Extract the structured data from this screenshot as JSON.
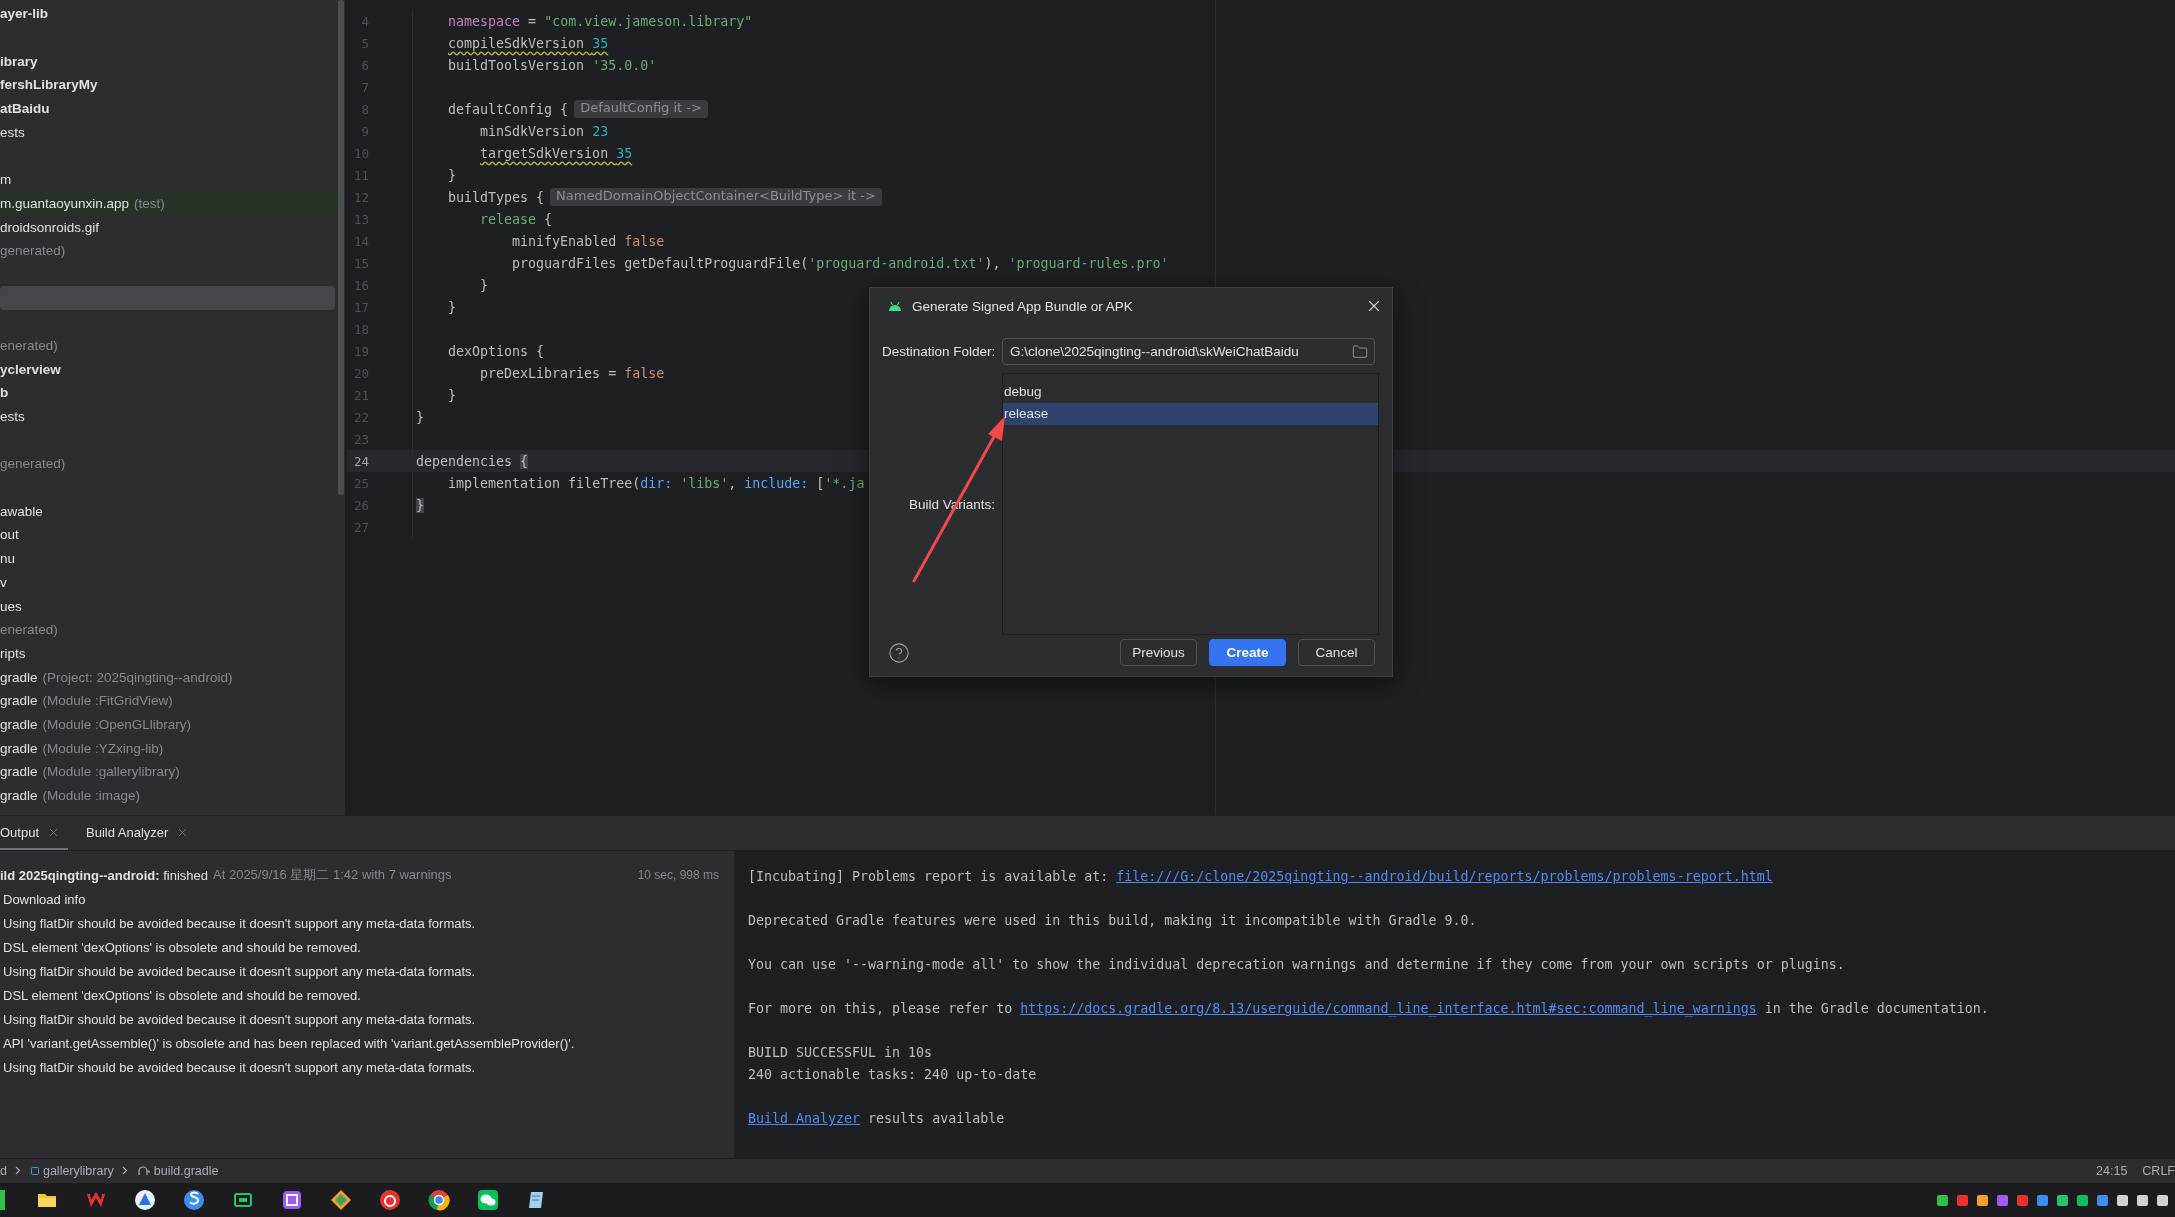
{
  "project_tree": {
    "rows": [
      {
        "kind": "module",
        "label": "ayer-lib",
        "selected": false
      },
      {
        "kind": "gap",
        "selected": false
      },
      {
        "kind": "module",
        "label": "ibrary",
        "selected": false
      },
      {
        "kind": "module",
        "label": "fershLibraryMy",
        "selected": false
      },
      {
        "kind": "module",
        "label": "atBaidu",
        "selected": false
      },
      {
        "kind": "folder",
        "label": "ests",
        "selected": false
      },
      {
        "kind": "gap",
        "selected": false
      },
      {
        "kind": "folder",
        "label": "m",
        "selected": false
      },
      {
        "kind": "test",
        "label": "m.guantaoyunxin.app",
        "note": "(test)",
        "selected": false
      },
      {
        "kind": "folder",
        "label": "droidsonroids.gif",
        "selected": false
      },
      {
        "kind": "folder",
        "note": "generated)",
        "selected": false
      },
      {
        "kind": "gap",
        "selected": false
      },
      {
        "kind": "gap",
        "selected": true
      },
      {
        "kind": "gap",
        "selected": false
      },
      {
        "kind": "folder",
        "note": "enerated)",
        "selected": false
      },
      {
        "kind": "module",
        "label": "yclerview",
        "selected": false
      },
      {
        "kind": "module",
        "label": "b",
        "selected": false
      },
      {
        "kind": "folder",
        "label": "ests",
        "selected": false
      },
      {
        "kind": "gap",
        "selected": false
      },
      {
        "kind": "folder",
        "note": "generated)",
        "selected": false
      },
      {
        "kind": "gap",
        "selected": false
      },
      {
        "kind": "folder",
        "label": "awable",
        "selected": false
      },
      {
        "kind": "folder",
        "label": "out",
        "selected": false
      },
      {
        "kind": "folder",
        "label": "nu",
        "selected": false
      },
      {
        "kind": "folder",
        "label": "v",
        "selected": false
      },
      {
        "kind": "folder",
        "label": "ues",
        "selected": false
      },
      {
        "kind": "folder",
        "note": "enerated)",
        "selected": false
      },
      {
        "kind": "folder",
        "label": "ripts",
        "selected": false
      },
      {
        "kind": "folder",
        "label": "gradle",
        "note": "(Project: 2025qingting--android)",
        "selected": false
      },
      {
        "kind": "folder",
        "label": "gradle",
        "note": "(Module :FitGridView)",
        "selected": false
      },
      {
        "kind": "folder",
        "label": "gradle",
        "note": "(Module :OpenGLlibrary)",
        "selected": false
      },
      {
        "kind": "folder",
        "label": "gradle",
        "note": "(Module :YZxing-lib)",
        "selected": false
      },
      {
        "kind": "folder",
        "label": "gradle",
        "note": "(Module :gallerylibrary)",
        "selected": false
      },
      {
        "kind": "folder",
        "label": "gradle",
        "note": "(Module :image)",
        "selected": false
      }
    ]
  },
  "editor": {
    "lines": [
      {
        "number": "4",
        "current": false,
        "tokens": [
          {
            "text": "    namespace",
            "kind": "property"
          },
          {
            "text": " = "
          },
          {
            "text": "\"com.view.jameson.library\"",
            "kind": "string"
          }
        ]
      },
      {
        "number": "5",
        "current": false,
        "tokens": [
          {
            "text": "    compileSdkVersion ",
            "wavy": true
          },
          {
            "text": "35",
            "kind": "number",
            "wavy": true
          }
        ]
      },
      {
        "number": "6",
        "current": false,
        "tokens": [
          {
            "text": "    buildToolsVersion "
          },
          {
            "text": "'35.0.0'",
            "kind": "string"
          }
        ]
      },
      {
        "number": "7",
        "current": false
      },
      {
        "number": "8",
        "current": false,
        "tokens": [
          {
            "text": "    defaultConfig {"
          }
        ],
        "hint": "DefaultConfig it ->"
      },
      {
        "number": "9",
        "current": false,
        "tokens": [
          {
            "text": "        minSdkVersion "
          },
          {
            "text": "23",
            "kind": "number"
          }
        ]
      },
      {
        "number": "10",
        "current": false,
        "tokens": [
          {
            "text": "        targetSdkVersion ",
            "wavy": true
          },
          {
            "text": "35",
            "kind": "number",
            "wavy": true
          }
        ]
      },
      {
        "number": "11",
        "current": false,
        "tokens": [
          {
            "text": "    }"
          }
        ]
      },
      {
        "number": "12",
        "current": false,
        "tokens": [
          {
            "text": "    buildTypes {"
          }
        ],
        "hint": "NamedDomainObjectContainer<BuildType> it ->"
      },
      {
        "number": "13",
        "current": false,
        "tokens": [
          {
            "text": "        release",
            "kind": "string"
          },
          {
            "text": " {"
          }
        ]
      },
      {
        "number": "14",
        "current": false,
        "tokens": [
          {
            "text": "            minifyEnabled "
          },
          {
            "text": "false",
            "kind": "keyword"
          }
        ]
      },
      {
        "number": "15",
        "current": false,
        "tokens": [
          {
            "text": "            proguardFiles getDefaultProguardFile("
          },
          {
            "text": "'proguard-android.txt'",
            "kind": "string"
          },
          {
            "text": "), "
          },
          {
            "text": "'proguard-rules.pro'",
            "kind": "string"
          }
        ]
      },
      {
        "number": "16",
        "current": false,
        "tokens": [
          {
            "text": "        }"
          }
        ]
      },
      {
        "number": "17",
        "current": false,
        "tokens": [
          {
            "text": "    }"
          }
        ]
      },
      {
        "number": "18",
        "current": false
      },
      {
        "number": "19",
        "current": false,
        "tokens": [
          {
            "text": "    dexOptions {"
          }
        ]
      },
      {
        "number": "20",
        "current": false,
        "tokens": [
          {
            "text": "        preDexLibraries = "
          },
          {
            "text": "false",
            "kind": "keyword"
          }
        ]
      },
      {
        "number": "21",
        "current": false,
        "tokens": [
          {
            "text": "    }"
          }
        ]
      },
      {
        "number": "22",
        "current": false,
        "tokens": [
          {
            "text": "}"
          }
        ]
      },
      {
        "number": "23",
        "current": false
      },
      {
        "number": "24",
        "current": true,
        "tokens": [
          {
            "text": "dependencies "
          },
          {
            "text": "{",
            "kind": "matched"
          }
        ]
      },
      {
        "number": "25",
        "current": false,
        "tokens": [
          {
            "text": "    implementation fileTree("
          },
          {
            "text": "dir:",
            "kind": "param"
          },
          {
            "text": " 'libs'",
            "kind": "string"
          },
          {
            "text": ", "
          },
          {
            "text": "include:",
            "kind": "param"
          },
          {
            "text": " ["
          },
          {
            "text": "'*.ja",
            "kind": "string"
          }
        ]
      },
      {
        "number": "26",
        "current": false,
        "tokens": [
          {
            "text": "}",
            "kind": "matched"
          }
        ]
      },
      {
        "number": "27",
        "current": false
      }
    ]
  },
  "dialog": {
    "title": "Generate Signed App Bundle or APK",
    "destination_label": "Destination Folder:",
    "destination_value": "G:\\clone\\2025qingting--android\\skWeiChatBaidu",
    "variants_label": "Build Variants:",
    "variants": [
      {
        "label": "debug",
        "selected": false
      },
      {
        "label": "release",
        "selected": true
      }
    ],
    "buttons": [
      {
        "label": "Previous",
        "kind": "secondary"
      },
      {
        "label": "Create",
        "kind": "primary"
      },
      {
        "label": "Cancel",
        "kind": "secondary"
      }
    ]
  },
  "bottom_panel": {
    "tabs": [
      {
        "label": "Output",
        "selected": true
      },
      {
        "label": "Build Analyzer",
        "selected": false
      }
    ],
    "build_summary": {
      "text": "**ild 2025qingting--android:** finished",
      "detail": "At 2025/9/16 星期二 1:42 with 7 warnings",
      "duration": "10 sec, 998 ms"
    },
    "messages": [
      "Download info",
      "Using flatDir should be avoided because it doesn't support any meta-data formats.",
      "DSL element 'dexOptions' is obsolete and should be removed.",
      "Using flatDir should be avoided because it doesn't support any meta-data formats.",
      "DSL element 'dexOptions' is obsolete and should be removed.",
      "Using flatDir should be avoided because it doesn't support any meta-data formats.",
      "API 'variant.getAssemble()' is obsolete and has been replaced with 'variant.getAssembleProvider()'.",
      "Using flatDir should be avoided because it doesn't support any meta-data formats."
    ],
    "console": [
      {
        "kind": "text",
        "parts": [
          {
            "text": "[Incubating] Problems report is available at: ",
            "link": false
          },
          {
            "text": "file:///G:/clone/2025qingting--android/build/reports/problems/problems-report.html",
            "link": true
          }
        ]
      },
      {
        "kind": "blank"
      },
      {
        "kind": "text",
        "parts": [
          {
            "text": "Deprecated Gradle features were used in this build, making it incompatible with Gradle 9.0.",
            "link": false
          }
        ]
      },
      {
        "kind": "blank"
      },
      {
        "kind": "text",
        "parts": [
          {
            "text": "You can use '--warning-mode all' to show the individual deprecation warnings and determine if they come from your own scripts or plugins.",
            "link": false
          }
        ]
      },
      {
        "kind": "blank"
      },
      {
        "kind": "text",
        "parts": [
          {
            "text": "For more on this, please refer to ",
            "link": false
          },
          {
            "text": "https://docs.gradle.org/8.13/userguide/command_line_interface.html#sec:command_line_warnings",
            "link": true
          },
          {
            "text": " in the Gradle documentation.",
            "link": false
          }
        ]
      },
      {
        "kind": "blank"
      },
      {
        "kind": "text",
        "parts": [
          {
            "text": "BUILD SUCCESSFUL in 10s",
            "link": false
          }
        ]
      },
      {
        "kind": "text",
        "parts": [
          {
            "text": "240 actionable tasks: 240 up-to-date",
            "link": false
          }
        ]
      },
      {
        "kind": "blank"
      },
      {
        "kind": "text",
        "parts": [
          {
            "text": "Build Analyzer",
            "link": true
          },
          {
            "text": " results available",
            "link": false
          }
        ]
      }
    ]
  },
  "status_bar": {
    "breadcrumbs": [
      {
        "label": "d",
        "kind": "text"
      },
      {
        "label": "gallerylibrary",
        "kind": "module"
      },
      {
        "label": "build.gradle",
        "kind": "gradle"
      }
    ],
    "position": "24:15",
    "line_ending": "CRLF"
  }
}
